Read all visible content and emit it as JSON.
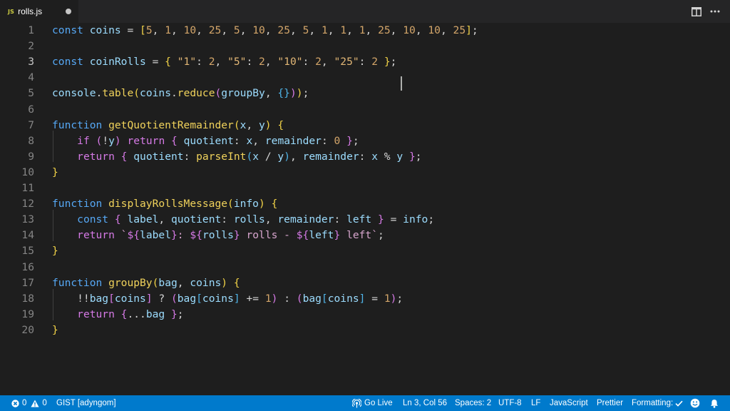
{
  "tab": {
    "lang_badge": "JS",
    "filename": "rolls.js",
    "modified_indicator": "dirty-dot-icon"
  },
  "toolbar_icons": [
    "split-editor-icon",
    "more-actions-icon"
  ],
  "editor": {
    "active_line": 3,
    "lines": [
      {
        "n": "1",
        "tokens": [
          [
            "kw",
            "const"
          ],
          [
            "pn",
            " "
          ],
          [
            "var",
            "coins"
          ],
          [
            "pn",
            " = "
          ],
          [
            "br1",
            "["
          ],
          [
            "num",
            "5"
          ],
          [
            "pn",
            ", "
          ],
          [
            "num",
            "1"
          ],
          [
            "pn",
            ", "
          ],
          [
            "num",
            "10"
          ],
          [
            "pn",
            ", "
          ],
          [
            "num",
            "25"
          ],
          [
            "pn",
            ", "
          ],
          [
            "num",
            "5"
          ],
          [
            "pn",
            ", "
          ],
          [
            "num",
            "10"
          ],
          [
            "pn",
            ", "
          ],
          [
            "num",
            "25"
          ],
          [
            "pn",
            ", "
          ],
          [
            "num",
            "5"
          ],
          [
            "pn",
            ", "
          ],
          [
            "num",
            "1"
          ],
          [
            "pn",
            ", "
          ],
          [
            "num",
            "1"
          ],
          [
            "pn",
            ", "
          ],
          [
            "num",
            "1"
          ],
          [
            "pn",
            ", "
          ],
          [
            "num",
            "25"
          ],
          [
            "pn",
            ", "
          ],
          [
            "num",
            "10"
          ],
          [
            "pn",
            ", "
          ],
          [
            "num",
            "10"
          ],
          [
            "pn",
            ", "
          ],
          [
            "num",
            "25"
          ],
          [
            "br1",
            "]"
          ],
          [
            "pn",
            ";"
          ]
        ]
      },
      {
        "n": "2",
        "tokens": []
      },
      {
        "n": "3",
        "tokens": [
          [
            "kw",
            "const"
          ],
          [
            "pn",
            " "
          ],
          [
            "var",
            "coinRolls"
          ],
          [
            "pn",
            " = "
          ],
          [
            "br1",
            "{"
          ],
          [
            "pn",
            " "
          ],
          [
            "str",
            "\"1\""
          ],
          [
            "pn",
            ": "
          ],
          [
            "num",
            "2"
          ],
          [
            "pn",
            ", "
          ],
          [
            "str",
            "\"5\""
          ],
          [
            "pn",
            ": "
          ],
          [
            "num",
            "2"
          ],
          [
            "pn",
            ", "
          ],
          [
            "str",
            "\"10\""
          ],
          [
            "pn",
            ": "
          ],
          [
            "num",
            "2"
          ],
          [
            "pn",
            ", "
          ],
          [
            "str",
            "\"25\""
          ],
          [
            "pn",
            ": "
          ],
          [
            "num",
            "2"
          ],
          [
            "pn",
            " "
          ],
          [
            "br1",
            "}"
          ],
          [
            "pn",
            ";"
          ]
        ]
      },
      {
        "n": "4",
        "tokens": []
      },
      {
        "n": "5",
        "tokens": [
          [
            "var",
            "console"
          ],
          [
            "pn",
            "."
          ],
          [
            "fn",
            "table"
          ],
          [
            "br1",
            "("
          ],
          [
            "var",
            "coins"
          ],
          [
            "pn",
            "."
          ],
          [
            "fn",
            "reduce"
          ],
          [
            "br2",
            "("
          ],
          [
            "var",
            "groupBy"
          ],
          [
            "pn",
            ", "
          ],
          [
            "br3",
            "{}"
          ],
          [
            "br2",
            ")"
          ],
          [
            "br1",
            ")"
          ],
          [
            "pn",
            ";"
          ]
        ]
      },
      {
        "n": "6",
        "tokens": []
      },
      {
        "n": "7",
        "tokens": [
          [
            "kw",
            "function"
          ],
          [
            "pn",
            " "
          ],
          [
            "fn",
            "getQuotientRemainder"
          ],
          [
            "br1",
            "("
          ],
          [
            "var",
            "x"
          ],
          [
            "pn",
            ", "
          ],
          [
            "var",
            "y"
          ],
          [
            "br1",
            ")"
          ],
          [
            "pn",
            " "
          ],
          [
            "br1",
            "{"
          ]
        ]
      },
      {
        "n": "8",
        "tokens": [
          [
            "pn",
            "    "
          ],
          [
            "ctl",
            "if"
          ],
          [
            "pn",
            " "
          ],
          [
            "br2",
            "("
          ],
          [
            "pn",
            "!"
          ],
          [
            "var",
            "y"
          ],
          [
            "br2",
            ")"
          ],
          [
            "pn",
            " "
          ],
          [
            "ctl",
            "return"
          ],
          [
            "pn",
            " "
          ],
          [
            "br2",
            "{"
          ],
          [
            "pn",
            " "
          ],
          [
            "var",
            "quotient"
          ],
          [
            "pn",
            ": "
          ],
          [
            "var",
            "x"
          ],
          [
            "pn",
            ", "
          ],
          [
            "var",
            "remainder"
          ],
          [
            "pn",
            ": "
          ],
          [
            "num",
            "0"
          ],
          [
            "pn",
            " "
          ],
          [
            "br2",
            "}"
          ],
          [
            "pn",
            ";"
          ]
        ]
      },
      {
        "n": "9",
        "tokens": [
          [
            "pn",
            "    "
          ],
          [
            "ctl",
            "return"
          ],
          [
            "pn",
            " "
          ],
          [
            "br2",
            "{"
          ],
          [
            "pn",
            " "
          ],
          [
            "var",
            "quotient"
          ],
          [
            "pn",
            ": "
          ],
          [
            "fn",
            "parseInt"
          ],
          [
            "br3",
            "("
          ],
          [
            "var",
            "x"
          ],
          [
            "pn",
            " / "
          ],
          [
            "var",
            "y"
          ],
          [
            "br3",
            ")"
          ],
          [
            "pn",
            ", "
          ],
          [
            "var",
            "remainder"
          ],
          [
            "pn",
            ": "
          ],
          [
            "var",
            "x"
          ],
          [
            "pn",
            " % "
          ],
          [
            "var",
            "y"
          ],
          [
            "pn",
            " "
          ],
          [
            "br2",
            "}"
          ],
          [
            "pn",
            ";"
          ]
        ]
      },
      {
        "n": "10",
        "tokens": [
          [
            "br1",
            "}"
          ]
        ]
      },
      {
        "n": "11",
        "tokens": []
      },
      {
        "n": "12",
        "tokens": [
          [
            "kw",
            "function"
          ],
          [
            "pn",
            " "
          ],
          [
            "fn",
            "displayRollsMessage"
          ],
          [
            "br1",
            "("
          ],
          [
            "var",
            "info"
          ],
          [
            "br1",
            ")"
          ],
          [
            "pn",
            " "
          ],
          [
            "br1",
            "{"
          ]
        ]
      },
      {
        "n": "13",
        "tokens": [
          [
            "pn",
            "    "
          ],
          [
            "kw",
            "const"
          ],
          [
            "pn",
            " "
          ],
          [
            "br2",
            "{"
          ],
          [
            "pn",
            " "
          ],
          [
            "var",
            "label"
          ],
          [
            "pn",
            ", "
          ],
          [
            "var",
            "quotient"
          ],
          [
            "pn",
            ": "
          ],
          [
            "var",
            "rolls"
          ],
          [
            "pn",
            ", "
          ],
          [
            "var",
            "remainder"
          ],
          [
            "pn",
            ": "
          ],
          [
            "var",
            "left"
          ],
          [
            "pn",
            " "
          ],
          [
            "br2",
            "}"
          ],
          [
            "pn",
            " = "
          ],
          [
            "var",
            "info"
          ],
          [
            "pn",
            ";"
          ]
        ]
      },
      {
        "n": "14",
        "tokens": [
          [
            "pn",
            "    "
          ],
          [
            "ctl",
            "return"
          ],
          [
            "pn",
            " "
          ],
          [
            "tpl",
            "`"
          ],
          [
            "br2",
            "${"
          ],
          [
            "var",
            "label"
          ],
          [
            "br2",
            "}"
          ],
          [
            "tpl",
            ": "
          ],
          [
            "br2",
            "${"
          ],
          [
            "var",
            "rolls"
          ],
          [
            "br2",
            "}"
          ],
          [
            "tpl",
            " rolls - "
          ],
          [
            "br2",
            "${"
          ],
          [
            "var",
            "left"
          ],
          [
            "br2",
            "}"
          ],
          [
            "tpl",
            " left`"
          ],
          [
            "pn",
            ";"
          ]
        ]
      },
      {
        "n": "15",
        "tokens": [
          [
            "br1",
            "}"
          ]
        ]
      },
      {
        "n": "16",
        "tokens": []
      },
      {
        "n": "17",
        "tokens": [
          [
            "kw",
            "function"
          ],
          [
            "pn",
            " "
          ],
          [
            "fn",
            "groupBy"
          ],
          [
            "br1",
            "("
          ],
          [
            "var",
            "bag"
          ],
          [
            "pn",
            ", "
          ],
          [
            "var",
            "coins"
          ],
          [
            "br1",
            ")"
          ],
          [
            "pn",
            " "
          ],
          [
            "br1",
            "{"
          ]
        ]
      },
      {
        "n": "18",
        "tokens": [
          [
            "pn",
            "    !!"
          ],
          [
            "var",
            "bag"
          ],
          [
            "br2",
            "["
          ],
          [
            "var",
            "coins"
          ],
          [
            "br2",
            "]"
          ],
          [
            "pn",
            " ? "
          ],
          [
            "br2",
            "("
          ],
          [
            "var",
            "bag"
          ],
          [
            "br3",
            "["
          ],
          [
            "var",
            "coins"
          ],
          [
            "br3",
            "]"
          ],
          [
            "pn",
            " += "
          ],
          [
            "num",
            "1"
          ],
          [
            "br2",
            ")"
          ],
          [
            "pn",
            " : "
          ],
          [
            "br2",
            "("
          ],
          [
            "var",
            "bag"
          ],
          [
            "br3",
            "["
          ],
          [
            "var",
            "coins"
          ],
          [
            "br3",
            "]"
          ],
          [
            "pn",
            " = "
          ],
          [
            "num",
            "1"
          ],
          [
            "br2",
            ")"
          ],
          [
            "pn",
            ";"
          ]
        ]
      },
      {
        "n": "19",
        "tokens": [
          [
            "pn",
            "    "
          ],
          [
            "ctl",
            "return"
          ],
          [
            "pn",
            " "
          ],
          [
            "br2",
            "{"
          ],
          [
            "pn",
            "..."
          ],
          [
            "var",
            "bag"
          ],
          [
            "pn",
            " "
          ],
          [
            "br2",
            "}"
          ],
          [
            "pn",
            ";"
          ]
        ]
      },
      {
        "n": "20",
        "tokens": [
          [
            "br1",
            "}"
          ]
        ]
      }
    ]
  },
  "statusbar": {
    "errors": "0",
    "warnings": "0",
    "gist": "GIST [adyngom]",
    "go_live": "Go Live",
    "position": "Ln 3, Col 56",
    "spaces": "Spaces: 2",
    "encoding": "UTF-8",
    "eol": "LF",
    "language": "JavaScript",
    "prettier": "Prettier",
    "formatting": "Formatting:",
    "bg_color": "#007acc"
  }
}
